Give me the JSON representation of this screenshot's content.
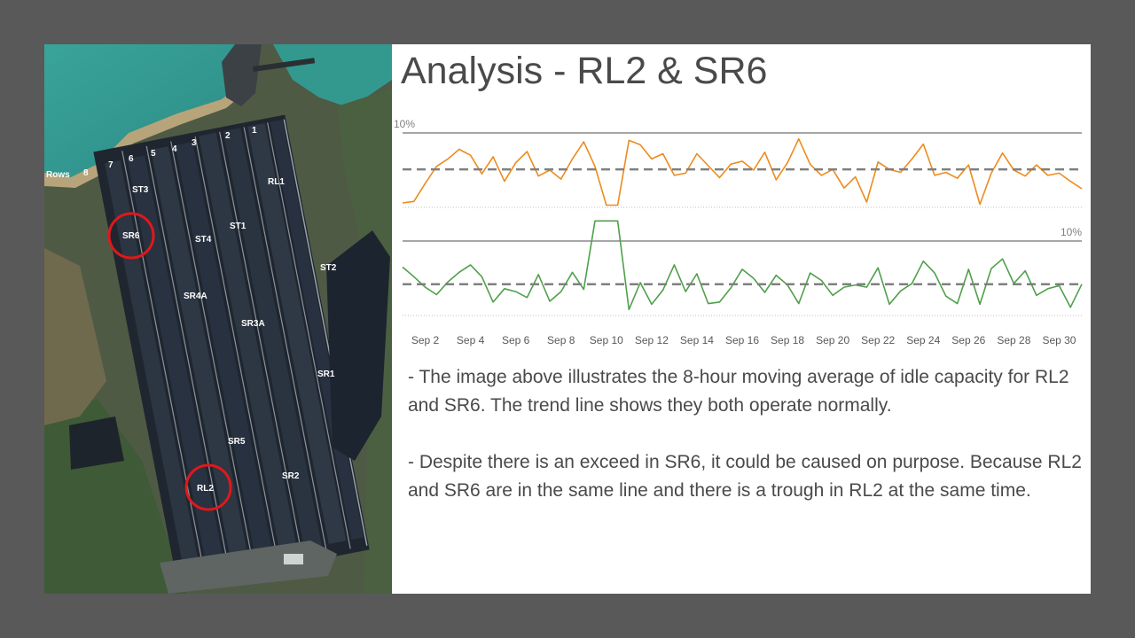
{
  "slide": {
    "title": "Analysis - RL2 & SR6",
    "paragraphs": [
      " - The image above illustrates the 8-hour moving average of idle capacity for RL2 and SR6. The trend line shows they both operate normally.",
      " - Despite there is an exceed in SR6, it could be caused on purpose. Because RL2 and SR6 are in the same line and there is a trough in RL2 at the same time."
    ]
  },
  "aerial_map": {
    "row_label": "Rows",
    "row_numbers": [
      "8",
      "7",
      "6",
      "5",
      "4",
      "3",
      "2",
      "1"
    ],
    "equipment_labels": [
      "ST3",
      "RL1",
      "SR6",
      "ST4",
      "ST1",
      "ST2",
      "SR4A",
      "SR3A",
      "SR1",
      "SR5",
      "RL2",
      "SR2"
    ],
    "circled": [
      "SR6",
      "RL2"
    ],
    "circle_color": "#e0181b"
  },
  "chart_data": {
    "type": "line",
    "x_tick_labels": [
      "Sep 2",
      "Sep 4",
      "Sep 6",
      "Sep 8",
      "Sep 10",
      "Sep 12",
      "Sep 14",
      "Sep 16",
      "Sep 18",
      "Sep 20",
      "Sep 22",
      "Sep 24",
      "Sep 26",
      "Sep 28",
      "Sep 30"
    ],
    "x_range": [
      1,
      31
    ],
    "panels": [
      {
        "label": "10%",
        "y_range": [
          0,
          10
        ],
        "color": "#ed8b1e",
        "trend_level": 5.1,
        "x": [
          1.0,
          1.5,
          2.0,
          2.5,
          3.0,
          3.5,
          4.0,
          4.5,
          5.0,
          5.5,
          6.0,
          6.5,
          7.0,
          7.5,
          8.0,
          8.5,
          9.0,
          9.5,
          10.0,
          10.5,
          11.0,
          11.5,
          12.0,
          12.5,
          13.0,
          13.5,
          14.0,
          14.5,
          15.0,
          15.5,
          16.0,
          16.5,
          17.0,
          17.5,
          18.0,
          18.5,
          19.0,
          19.5,
          20.0,
          20.5,
          21.0,
          21.5,
          22.0,
          22.5,
          23.0,
          23.5,
          24.0,
          24.5,
          25.0,
          25.5,
          26.0,
          26.5,
          27.0,
          27.5,
          28.0,
          28.5,
          29.0,
          29.5,
          30.0,
          30.5,
          31.0
        ],
        "values": [
          0.6,
          0.8,
          3.2,
          5.5,
          6.5,
          7.8,
          7.0,
          4.5,
          6.8,
          3.5,
          6.0,
          7.5,
          4.2,
          5.0,
          3.8,
          6.5,
          8.8,
          5.5,
          0.3,
          0.3,
          9.0,
          8.4,
          6.5,
          7.2,
          4.3,
          4.6,
          7.2,
          5.6,
          4.0,
          5.8,
          6.2,
          5.0,
          7.4,
          3.7,
          6.0,
          9.2,
          5.8,
          4.3,
          5.1,
          2.6,
          4.1,
          0.7,
          6.1,
          5.1,
          4.7,
          6.5,
          8.5,
          4.3,
          4.7,
          3.9,
          5.7,
          0.4,
          4.6,
          7.3,
          5.0,
          4.2,
          5.7,
          4.3,
          4.6,
          3.5,
          2.5
        ]
      },
      {
        "label": "10%",
        "y_range": [
          0,
          10
        ],
        "color": "#4fa04a",
        "trend_level": 4.2,
        "x": [
          1.0,
          1.5,
          2.0,
          2.5,
          3.0,
          3.5,
          4.0,
          4.5,
          5.0,
          5.5,
          6.0,
          6.5,
          7.0,
          7.5,
          8.0,
          8.5,
          9.0,
          9.5,
          10.0,
          10.5,
          11.0,
          11.5,
          12.0,
          12.5,
          13.0,
          13.5,
          14.0,
          14.5,
          15.0,
          15.5,
          16.0,
          16.5,
          17.0,
          17.5,
          18.0,
          18.5,
          19.0,
          19.5,
          20.0,
          20.5,
          21.0,
          21.5,
          22.0,
          22.5,
          23.0,
          23.5,
          24.0,
          24.5,
          25.0,
          25.5,
          26.0,
          26.5,
          27.0,
          27.5,
          28.0,
          28.5,
          29.0,
          29.5,
          30.0,
          30.5,
          31.0
        ],
        "values": [
          6.5,
          5.2,
          3.8,
          2.8,
          4.5,
          5.8,
          6.8,
          5.2,
          1.8,
          3.6,
          3.2,
          2.4,
          5.5,
          1.9,
          3.2,
          5.8,
          3.5,
          12.8,
          12.8,
          12.8,
          0.8,
          4.4,
          1.5,
          3.4,
          6.8,
          3.2,
          5.6,
          1.6,
          1.8,
          3.7,
          6.2,
          5.0,
          3.1,
          5.4,
          4.1,
          1.6,
          5.7,
          4.7,
          2.7,
          3.8,
          4.1,
          3.8,
          6.4,
          1.5,
          3.3,
          4.3,
          7.3,
          5.7,
          2.6,
          1.6,
          6.2,
          1.5,
          6.3,
          7.6,
          4.3,
          6.0,
          2.7,
          3.6,
          4.0,
          1.1,
          4.2
        ]
      }
    ]
  }
}
